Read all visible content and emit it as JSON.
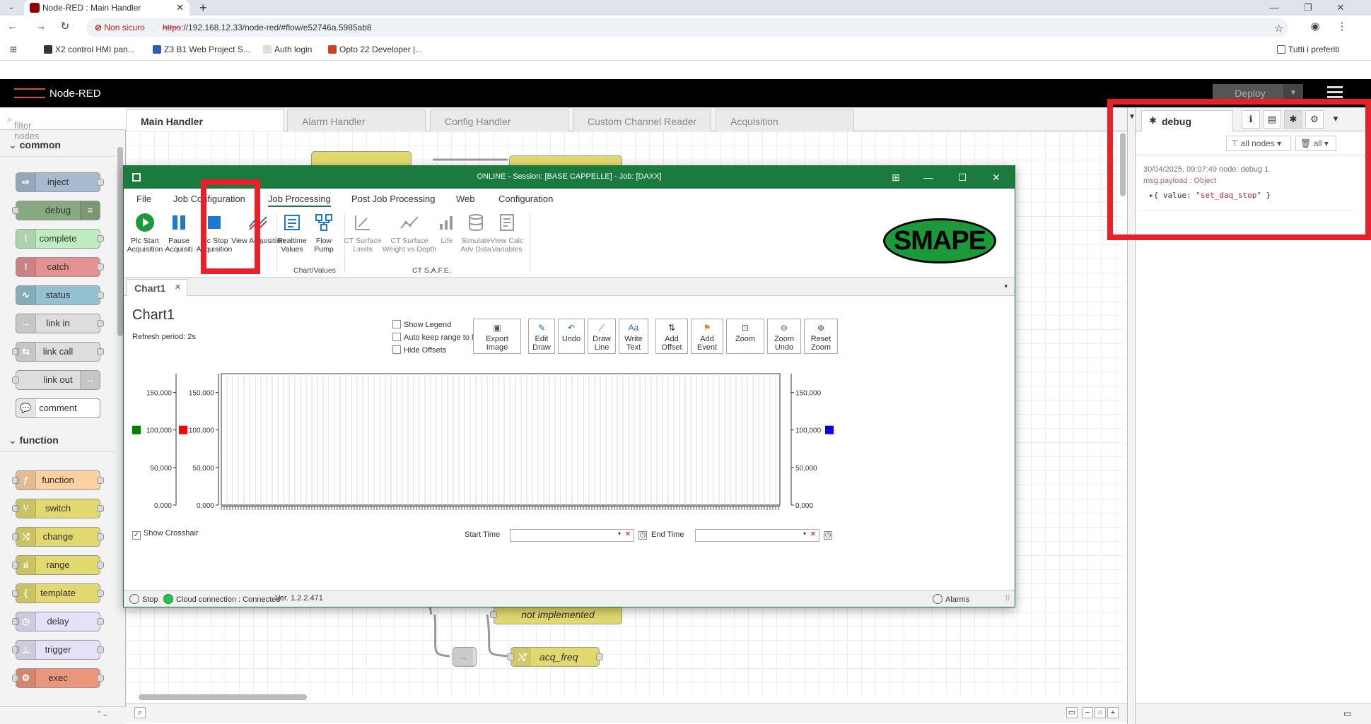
{
  "browser": {
    "tab_title": "Node-RED : Main Handler",
    "insecure_label": "Non sicuro",
    "url_scheme": "https",
    "url_rest": "://192.168.12.33/node-red/#flow/e52746a.5985ab8",
    "bookmarks": [
      "X2 control HMI pan...",
      "Z3 B1 Web Project S...",
      "Auth login",
      "Opto 22 Developer |..."
    ],
    "all_bookmarks": "Tutti i preferiti"
  },
  "nodered": {
    "brand": "Node-RED",
    "deploy_label": "Deploy",
    "filter_placeholder": "filter nodes",
    "categories": [
      "common",
      "function"
    ],
    "common_nodes": [
      "inject",
      "debug",
      "complete",
      "catch",
      "status",
      "link in",
      "link call",
      "link out",
      "comment"
    ],
    "function_nodes": [
      "function",
      "switch",
      "change",
      "range",
      "template",
      "delay",
      "trigger",
      "exec"
    ],
    "flow_tabs": [
      "Main Handler",
      "Alarm Handler",
      "Config Handler",
      "Custom Channel Reader",
      "Acquisition"
    ],
    "flow_nodes": [
      "not implemented",
      "acq_freq"
    ],
    "colors": {
      "function": "#fdd0a2",
      "inject": "#a6bbcf",
      "debug": "#87a980",
      "complete": "#c0edc0",
      "catch": "#e49191",
      "status": "#94c1d0",
      "link": "#dddddd",
      "change": "#e2d96e",
      "exec": "#e9967a",
      "delay": "#e6e0f8"
    }
  },
  "sidebar": {
    "tab_label": "debug",
    "filter_nodes": "all nodes",
    "filter_clear": "all",
    "message": {
      "meta": "30/04/2025, 09:07:49   node: debug 1",
      "topic": "msg.payload : Object",
      "value_prefix": "{ value: ",
      "value_str": "\"set_daq_stop\"",
      "value_suffix": " }"
    }
  },
  "app": {
    "title": "ONLINE - Session: [BASE CAPPELLE] - Job: [DAXX]",
    "menu": [
      "File",
      "Job Configuration",
      "Job Processing",
      "Post Job Processing",
      "Web",
      "Configuration"
    ],
    "ribbon": [
      {
        "label1": "Plc Start",
        "label2": "Acquisition"
      },
      {
        "label1": "Pause",
        "label2": "Acquisiti"
      },
      {
        "label1": "Plc Stop",
        "label2": "Acquisition"
      },
      {
        "label1": "View Acquisition",
        "label2": ""
      },
      {
        "label1": "Realtime",
        "label2": "Values"
      },
      {
        "label1": "Flow Pump",
        "label2": ""
      },
      {
        "label1": "CT Surface",
        "label2": "Limits"
      },
      {
        "label1": "CT Surface",
        "label2": "Weight vs Depth"
      },
      {
        "label1": "Life",
        "label2": ""
      },
      {
        "label1": "Simulate",
        "label2": "Adv Data"
      },
      {
        "label1": "View Calc",
        "label2": "Variables"
      }
    ],
    "groups": [
      "Chart/Values",
      "CT S.A.F.E."
    ],
    "logo": "SMAPE",
    "doc_tab": "Chart1",
    "chart_title": "Chart1",
    "refresh": "Refresh period: 2s",
    "checkboxes": [
      "Show Legend",
      "Auto keep range to last",
      "Hide Offsets"
    ],
    "tools": [
      {
        "l1": "Export",
        "l2": "Image"
      },
      {
        "l1": "Edit Draw",
        "l2": ""
      },
      {
        "l1": "Undo",
        "l2": ""
      },
      {
        "l1": "Draw",
        "l2": "Line"
      },
      {
        "l1": "Write Text",
        "l2": ""
      },
      {
        "l1": "Add Offset",
        "l2": ""
      },
      {
        "l1": "Add Event",
        "l2": ""
      },
      {
        "l1": "Zoom",
        "l2": ""
      },
      {
        "l1": "Zoom Undo",
        "l2": ""
      },
      {
        "l1": "Reset Zoom",
        "l2": ""
      }
    ],
    "show_crosshair": "Show Crosshair",
    "start_time": "Start Time",
    "end_time": "End Time",
    "status_stop": "Stop",
    "status_cloud": "Cloud connection : Connected",
    "version": "Ver. 1.2.2.471",
    "alarms": "Alarms"
  },
  "chart_data": {
    "type": "line",
    "title": "Chart1",
    "xlabel": "",
    "ylabel": "",
    "ylim": [
      0,
      175000
    ],
    "y_ticks": [
      "0,000",
      "50,000",
      "100,000",
      "150,000"
    ],
    "series": [],
    "axis_markers": [
      {
        "color": "#008000",
        "side": "left-outer"
      },
      {
        "color": "#ff0000",
        "side": "left-inner"
      },
      {
        "color": "#0000ff",
        "side": "right"
      }
    ],
    "grid": true
  }
}
